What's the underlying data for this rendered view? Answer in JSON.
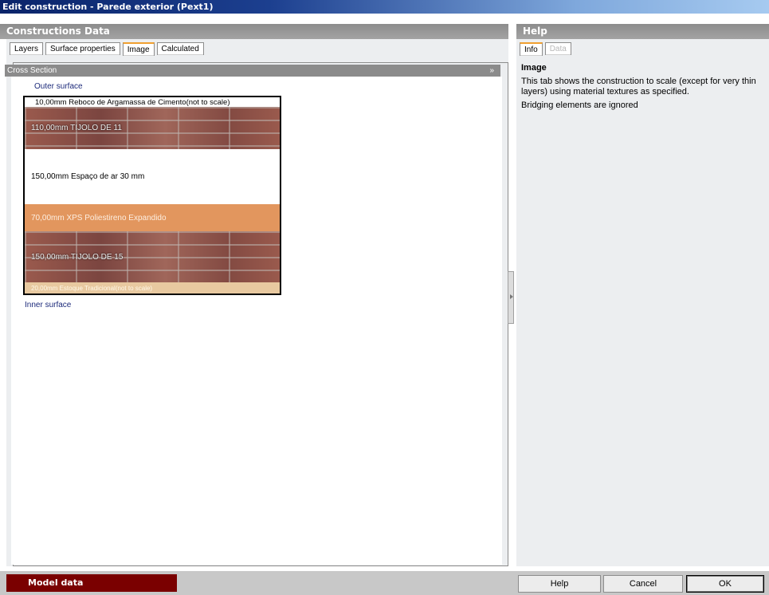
{
  "window": {
    "title": "Edit construction - Parede exterior (Pext1)"
  },
  "left_panel": {
    "header": "Constructions Data",
    "tabs": [
      {
        "label": "Layers",
        "active": false
      },
      {
        "label": "Surface properties",
        "active": false
      },
      {
        "label": "Image",
        "active": true
      },
      {
        "label": "Calculated",
        "active": false
      }
    ],
    "section": {
      "title": "Cross Section",
      "chevron": "»"
    },
    "outer_surface": "Outer surface",
    "inner_surface": "Inner surface",
    "layers": [
      {
        "text": "10,00mm   Reboco de Argamassa de Cimento(not to scale)",
        "style": "plain"
      },
      {
        "text": "110,00mm  TIJOLO DE 11",
        "style": "brick"
      },
      {
        "text": "150,00mm  Espaço de ar 30 mm",
        "style": "air"
      },
      {
        "text": "70,00mm   XPS Poliestireno Expandido",
        "style": "insulation"
      },
      {
        "text": "150,00mm  TIJOLO DE 15",
        "style": "brick"
      },
      {
        "text": "20,00mm  Estoque Tradicional(not to scale)",
        "style": "plaster"
      }
    ]
  },
  "right_panel": {
    "header": "Help",
    "tabs": [
      {
        "label": "Info",
        "active": true
      },
      {
        "label": "Data",
        "active": false
      }
    ],
    "title": "Image",
    "paragraphs": [
      "This tab shows the construction to scale (except for very thin layers) using material textures as specified.",
      "Bridging elements are ignored"
    ]
  },
  "footer": {
    "model_data": "Model data",
    "help": "Help",
    "cancel": "Cancel",
    "ok": "OK"
  }
}
